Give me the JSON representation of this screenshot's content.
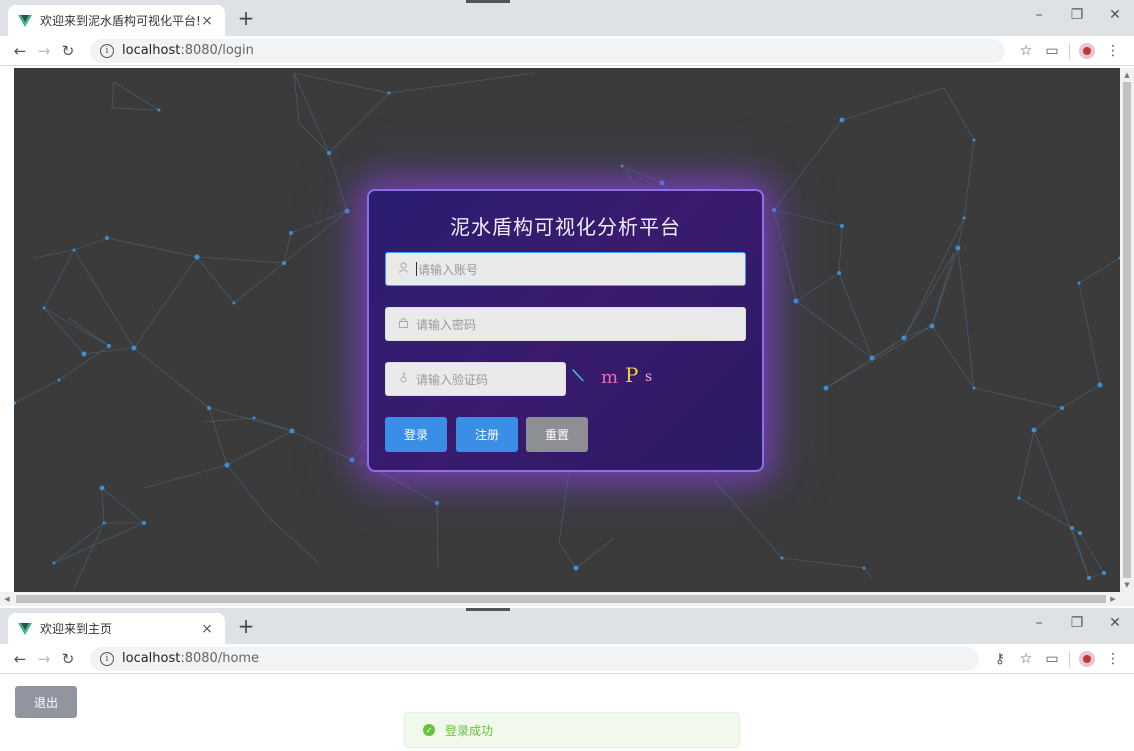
{
  "window1": {
    "tab_title": "欢迎来到泥水盾构可视化平台!",
    "tab_close": "×",
    "new_tab": "+",
    "url_host": "localhost",
    "url_path": ":8080/login",
    "login": {
      "title": "泥水盾构可视化分析平台",
      "account_placeholder": "请输入账号",
      "password_placeholder": "请输入密码",
      "captcha_placeholder": "请输入验证码",
      "captcha_chars": [
        "\\",
        "m",
        "P",
        "s"
      ],
      "login_button": "登录",
      "register_button": "注册",
      "reset_button": "重置"
    }
  },
  "window2": {
    "tab_title": "欢迎来到主页",
    "tab_close": "×",
    "new_tab": "+",
    "url_host": "localhost",
    "url_path": ":8080/home",
    "logout_button": "退出",
    "toast_message": "登录成功"
  },
  "colors": {
    "accent": "#409eff",
    "vue_green": "#41b883",
    "success": "#67c23a",
    "card_glow": "#963ce6",
    "background": "#3b3b3b",
    "node": "#3b8fd6"
  },
  "icons": {
    "back": "arrow-left-icon",
    "forward": "arrow-right-icon",
    "reload": "reload-icon",
    "info": "info-icon",
    "star": "star-icon",
    "key": "key-icon",
    "menu": "kebab-menu-icon"
  }
}
